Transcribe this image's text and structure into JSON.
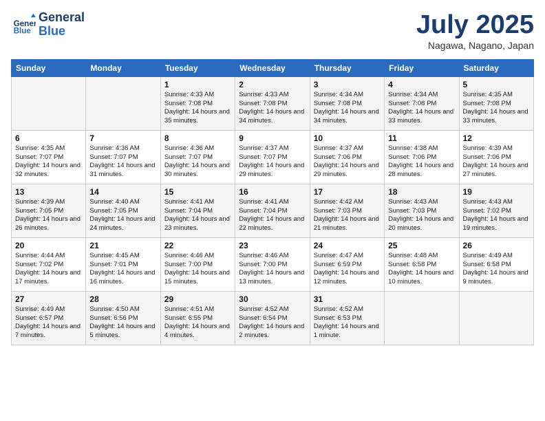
{
  "header": {
    "logo_line1": "General",
    "logo_line2": "Blue",
    "month": "July 2025",
    "location": "Nagawa, Nagano, Japan"
  },
  "weekdays": [
    "Sunday",
    "Monday",
    "Tuesday",
    "Wednesday",
    "Thursday",
    "Friday",
    "Saturday"
  ],
  "weeks": [
    [
      {
        "day": "",
        "info": ""
      },
      {
        "day": "",
        "info": ""
      },
      {
        "day": "1",
        "info": "Sunrise: 4:33 AM\nSunset: 7:08 PM\nDaylight: 14 hours and 35 minutes."
      },
      {
        "day": "2",
        "info": "Sunrise: 4:33 AM\nSunset: 7:08 PM\nDaylight: 14 hours and 34 minutes."
      },
      {
        "day": "3",
        "info": "Sunrise: 4:34 AM\nSunset: 7:08 PM\nDaylight: 14 hours and 34 minutes."
      },
      {
        "day": "4",
        "info": "Sunrise: 4:34 AM\nSunset: 7:08 PM\nDaylight: 14 hours and 33 minutes."
      },
      {
        "day": "5",
        "info": "Sunrise: 4:35 AM\nSunset: 7:08 PM\nDaylight: 14 hours and 33 minutes."
      }
    ],
    [
      {
        "day": "6",
        "info": "Sunrise: 4:35 AM\nSunset: 7:07 PM\nDaylight: 14 hours and 32 minutes."
      },
      {
        "day": "7",
        "info": "Sunrise: 4:36 AM\nSunset: 7:07 PM\nDaylight: 14 hours and 31 minutes."
      },
      {
        "day": "8",
        "info": "Sunrise: 4:36 AM\nSunset: 7:07 PM\nDaylight: 14 hours and 30 minutes."
      },
      {
        "day": "9",
        "info": "Sunrise: 4:37 AM\nSunset: 7:07 PM\nDaylight: 14 hours and 29 minutes."
      },
      {
        "day": "10",
        "info": "Sunrise: 4:37 AM\nSunset: 7:06 PM\nDaylight: 14 hours and 29 minutes."
      },
      {
        "day": "11",
        "info": "Sunrise: 4:38 AM\nSunset: 7:06 PM\nDaylight: 14 hours and 28 minutes."
      },
      {
        "day": "12",
        "info": "Sunrise: 4:39 AM\nSunset: 7:06 PM\nDaylight: 14 hours and 27 minutes."
      }
    ],
    [
      {
        "day": "13",
        "info": "Sunrise: 4:39 AM\nSunset: 7:05 PM\nDaylight: 14 hours and 26 minutes."
      },
      {
        "day": "14",
        "info": "Sunrise: 4:40 AM\nSunset: 7:05 PM\nDaylight: 14 hours and 24 minutes."
      },
      {
        "day": "15",
        "info": "Sunrise: 4:41 AM\nSunset: 7:04 PM\nDaylight: 14 hours and 23 minutes."
      },
      {
        "day": "16",
        "info": "Sunrise: 4:41 AM\nSunset: 7:04 PM\nDaylight: 14 hours and 22 minutes."
      },
      {
        "day": "17",
        "info": "Sunrise: 4:42 AM\nSunset: 7:03 PM\nDaylight: 14 hours and 21 minutes."
      },
      {
        "day": "18",
        "info": "Sunrise: 4:43 AM\nSunset: 7:03 PM\nDaylight: 14 hours and 20 minutes."
      },
      {
        "day": "19",
        "info": "Sunrise: 4:43 AM\nSunset: 7:02 PM\nDaylight: 14 hours and 19 minutes."
      }
    ],
    [
      {
        "day": "20",
        "info": "Sunrise: 4:44 AM\nSunset: 7:02 PM\nDaylight: 14 hours and 17 minutes."
      },
      {
        "day": "21",
        "info": "Sunrise: 4:45 AM\nSunset: 7:01 PM\nDaylight: 14 hours and 16 minutes."
      },
      {
        "day": "22",
        "info": "Sunrise: 4:46 AM\nSunset: 7:00 PM\nDaylight: 14 hours and 15 minutes."
      },
      {
        "day": "23",
        "info": "Sunrise: 4:46 AM\nSunset: 7:00 PM\nDaylight: 14 hours and 13 minutes."
      },
      {
        "day": "24",
        "info": "Sunrise: 4:47 AM\nSunset: 6:59 PM\nDaylight: 14 hours and 12 minutes."
      },
      {
        "day": "25",
        "info": "Sunrise: 4:48 AM\nSunset: 6:58 PM\nDaylight: 14 hours and 10 minutes."
      },
      {
        "day": "26",
        "info": "Sunrise: 4:49 AM\nSunset: 6:58 PM\nDaylight: 14 hours and 9 minutes."
      }
    ],
    [
      {
        "day": "27",
        "info": "Sunrise: 4:49 AM\nSunset: 6:57 PM\nDaylight: 14 hours and 7 minutes."
      },
      {
        "day": "28",
        "info": "Sunrise: 4:50 AM\nSunset: 6:56 PM\nDaylight: 14 hours and 5 minutes."
      },
      {
        "day": "29",
        "info": "Sunrise: 4:51 AM\nSunset: 6:55 PM\nDaylight: 14 hours and 4 minutes."
      },
      {
        "day": "30",
        "info": "Sunrise: 4:52 AM\nSunset: 6:54 PM\nDaylight: 14 hours and 2 minutes."
      },
      {
        "day": "31",
        "info": "Sunrise: 4:52 AM\nSunset: 6:53 PM\nDaylight: 14 hours and 1 minute."
      },
      {
        "day": "",
        "info": ""
      },
      {
        "day": "",
        "info": ""
      }
    ]
  ]
}
